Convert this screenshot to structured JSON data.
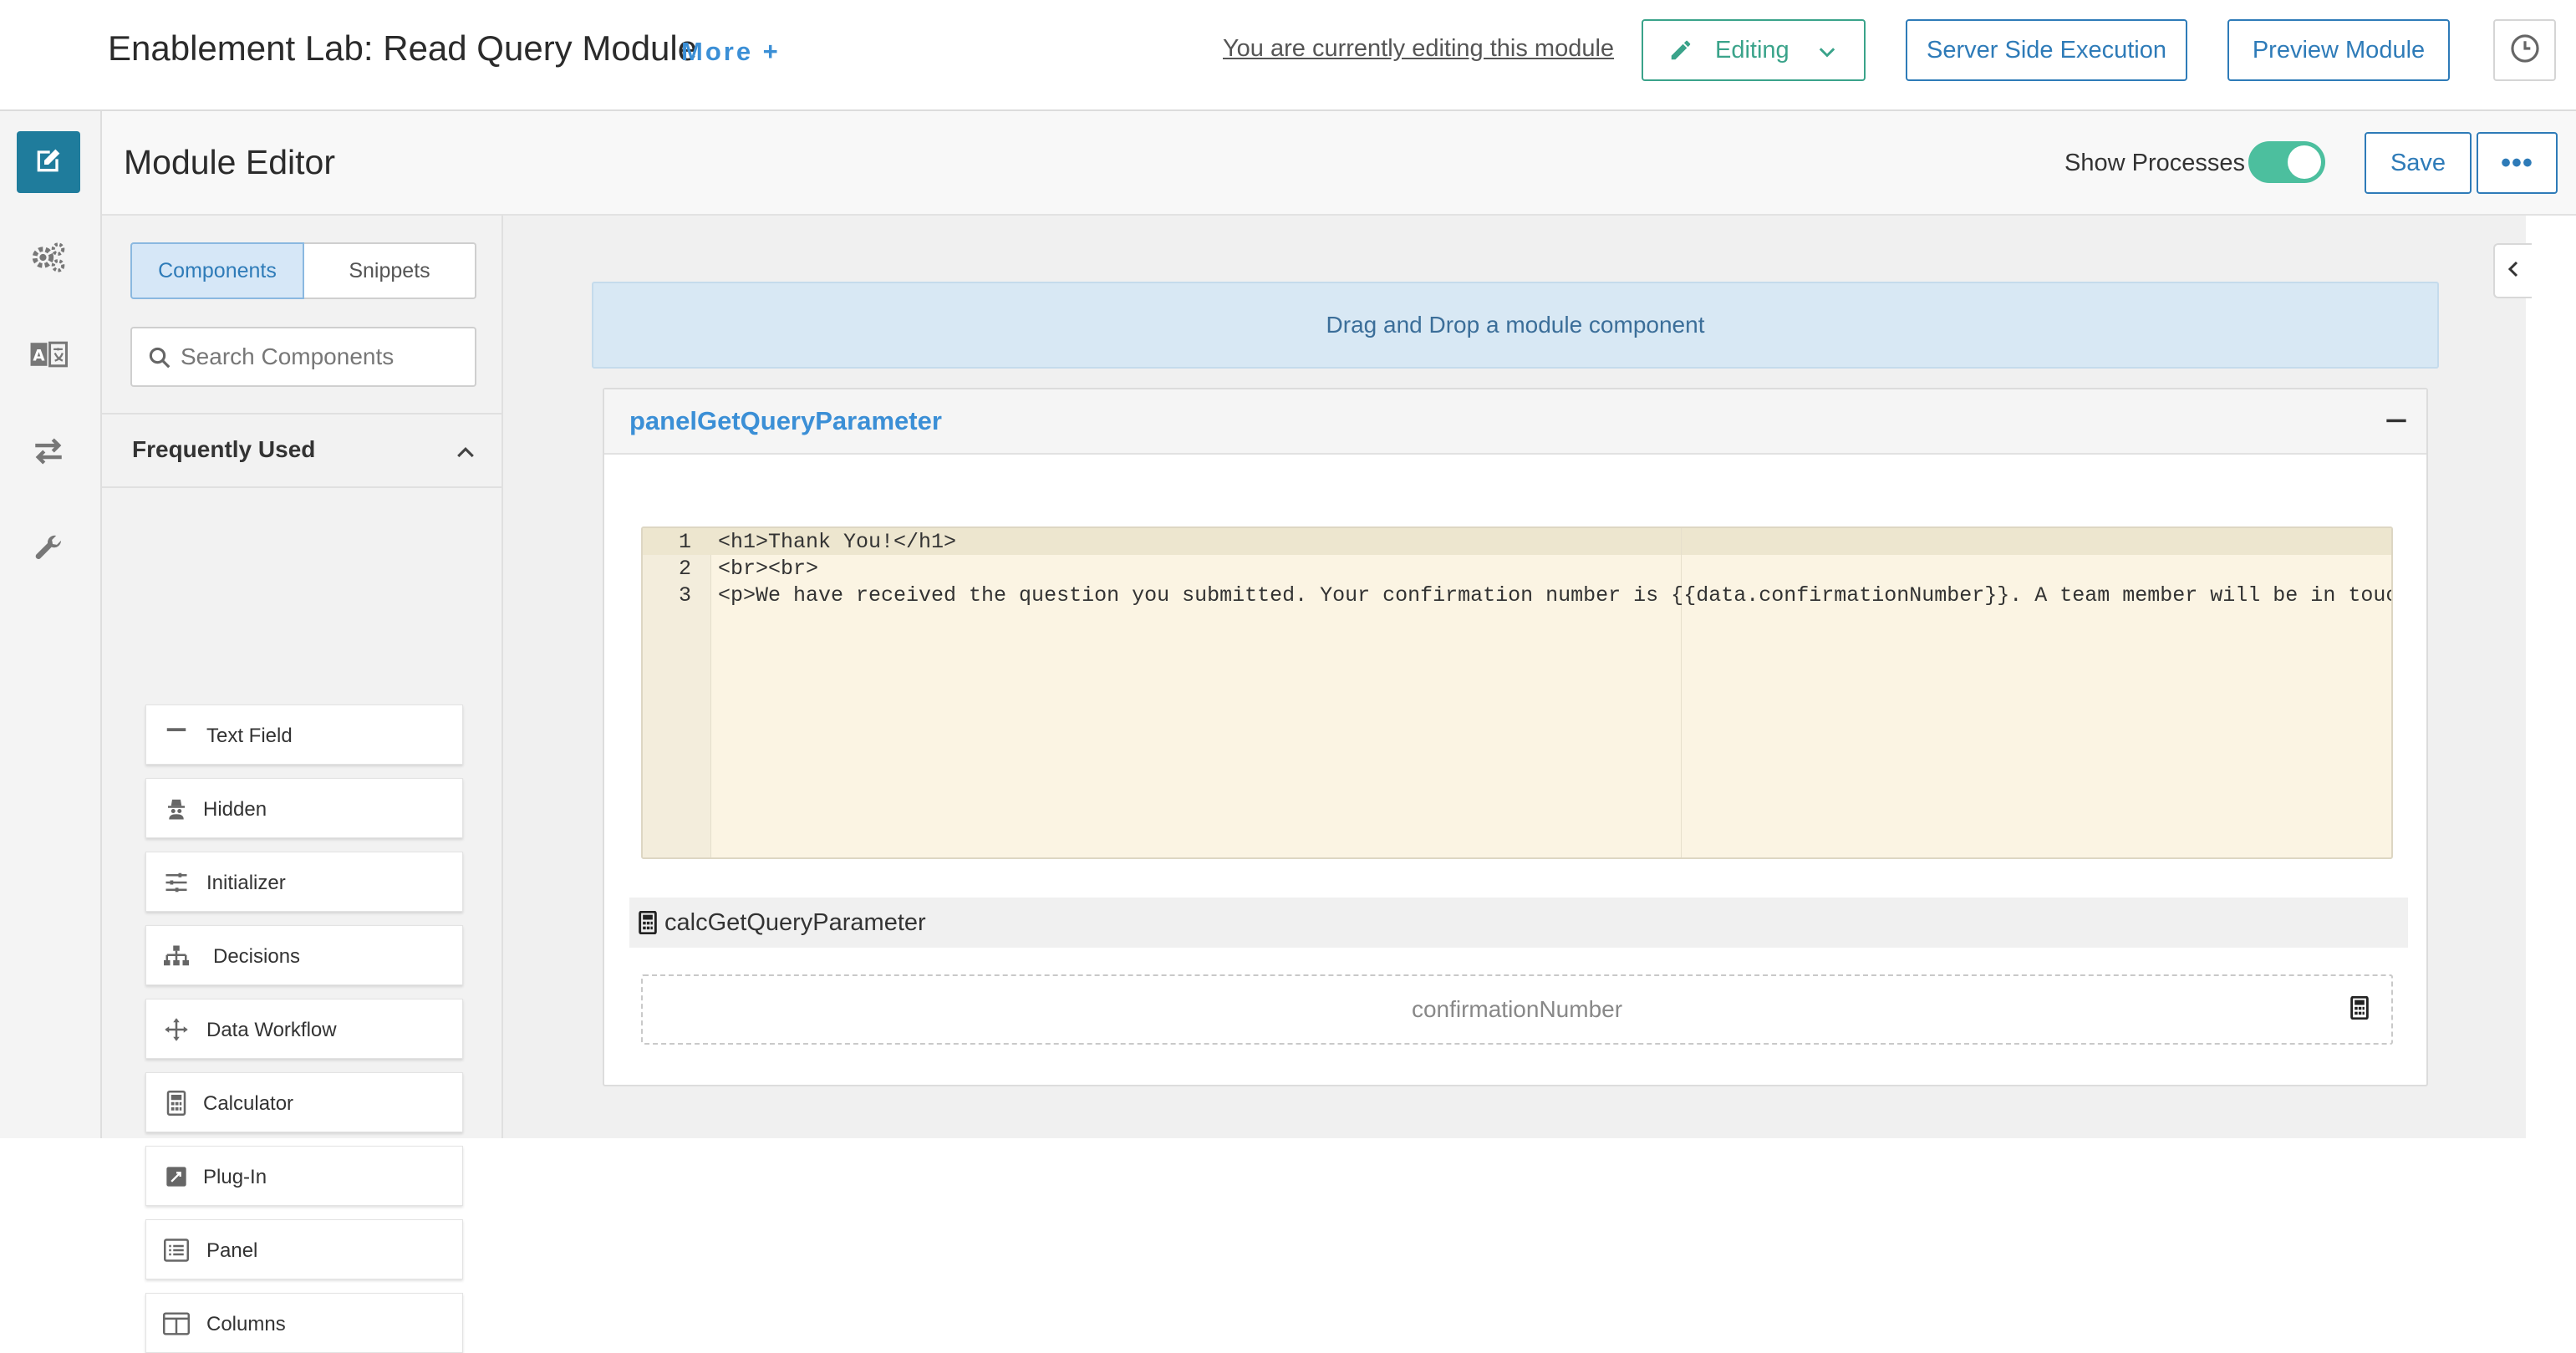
{
  "header": {
    "title": "Enablement Lab: Read Query Module",
    "more_label": "More +",
    "editing_note": "You are currently editing this module",
    "editing_button": "Editing",
    "server_side_button": "Server Side Execution",
    "preview_button": "Preview Module"
  },
  "rail": {
    "items": [
      "edit-icon",
      "gears-icon",
      "translate-icon",
      "transfer-icon",
      "wrench-icon"
    ]
  },
  "editor": {
    "title": "Module Editor",
    "show_processes_label": "Show Processes",
    "show_processes_on": true,
    "save_button": "Save",
    "more_button": "•••"
  },
  "sidebar": {
    "tabs": [
      "Components",
      "Snippets"
    ],
    "active_tab": "Components",
    "search_placeholder": "Search Components",
    "section_title": "Frequently Used",
    "components": [
      {
        "label": "Text Field",
        "icon": "text-field-icon"
      },
      {
        "label": "Hidden",
        "icon": "hidden-icon"
      },
      {
        "label": "Initializer",
        "icon": "sliders-icon"
      },
      {
        "label": "Decisions",
        "icon": "sitemap-icon"
      },
      {
        "label": "Data Workflow",
        "icon": "arrows-move-icon"
      },
      {
        "label": "Calculator",
        "icon": "calculator-icon"
      },
      {
        "label": "Plug-In",
        "icon": "plugin-icon"
      },
      {
        "label": "Panel",
        "icon": "panel-list-icon"
      },
      {
        "label": "Columns",
        "icon": "columns-icon"
      }
    ]
  },
  "canvas": {
    "dropzone_text": "Drag and Drop a module component",
    "panel_title": "panelGetQueryParameter",
    "code_lines": [
      {
        "num": "1",
        "text": "<h1>Thank You!</h1>"
      },
      {
        "num": "2",
        "text": "<br><br>"
      },
      {
        "num": "3",
        "text": "<p>We have received the question you submitted. Your confirmation number is {{data.confirmationNumber}}. A team member will be in touch wit"
      }
    ],
    "calc_title": "calcGetQueryParameter",
    "calc_field_label": "confirmationNumber"
  },
  "colors": {
    "accent_blue": "#2e7bb8",
    "link_blue": "#3b8fd6",
    "editing_green": "#3aa38a",
    "toggle_green": "#4cbf9e",
    "rail_active": "#1f7c9c",
    "dropzone_bg": "#d8e8f4",
    "code_bg": "#fbf4e3"
  }
}
